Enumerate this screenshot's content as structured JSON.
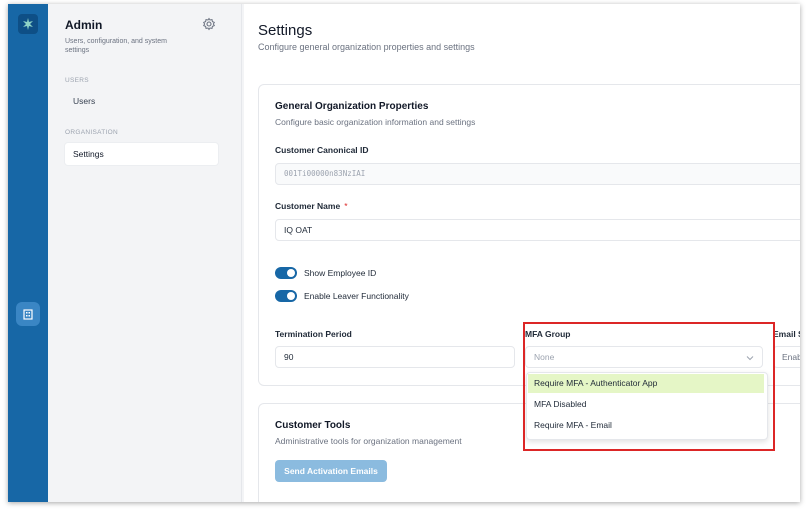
{
  "sidebar": {
    "title": "Admin",
    "subtitle": "Users, configuration, and system settings",
    "sections": [
      {
        "label": "USERS",
        "items": [
          {
            "label": "Users"
          }
        ]
      },
      {
        "label": "ORGANISATION",
        "items": [
          {
            "label": "Settings",
            "active": true
          }
        ]
      }
    ]
  },
  "page": {
    "title": "Settings",
    "subtitle": "Configure general organization properties and settings"
  },
  "general": {
    "title": "General Organization Properties",
    "subtitle": "Configure basic organization information and settings",
    "canonical_id_label": "Customer Canonical ID",
    "canonical_id_value": "001Ti00000n83NzIAI",
    "customer_name_label": "Customer Name",
    "required_mark": "*",
    "customer_name_value": "IQ OAT",
    "toggles": [
      {
        "label": "Show Employee ID",
        "on": true
      },
      {
        "label": "Enable Leaver Functionality",
        "on": true
      }
    ],
    "termination_label": "Termination Period",
    "termination_value": "90",
    "mfa_label": "MFA Group",
    "mfa_placeholder": "None",
    "mfa_options": [
      "Require MFA - Authenticator App",
      "MFA Disabled",
      "Require MFA - Email"
    ],
    "email_label": "Email S",
    "email_value": "Enab"
  },
  "tools": {
    "title": "Customer Tools",
    "subtitle": "Administrative tools for organization management",
    "send_button": "Send Activation Emails"
  },
  "colors": {
    "rail": "#1767a6",
    "accent": "#1767a6",
    "highlight": "#e5f6c6",
    "annotation": "#dc2626"
  }
}
